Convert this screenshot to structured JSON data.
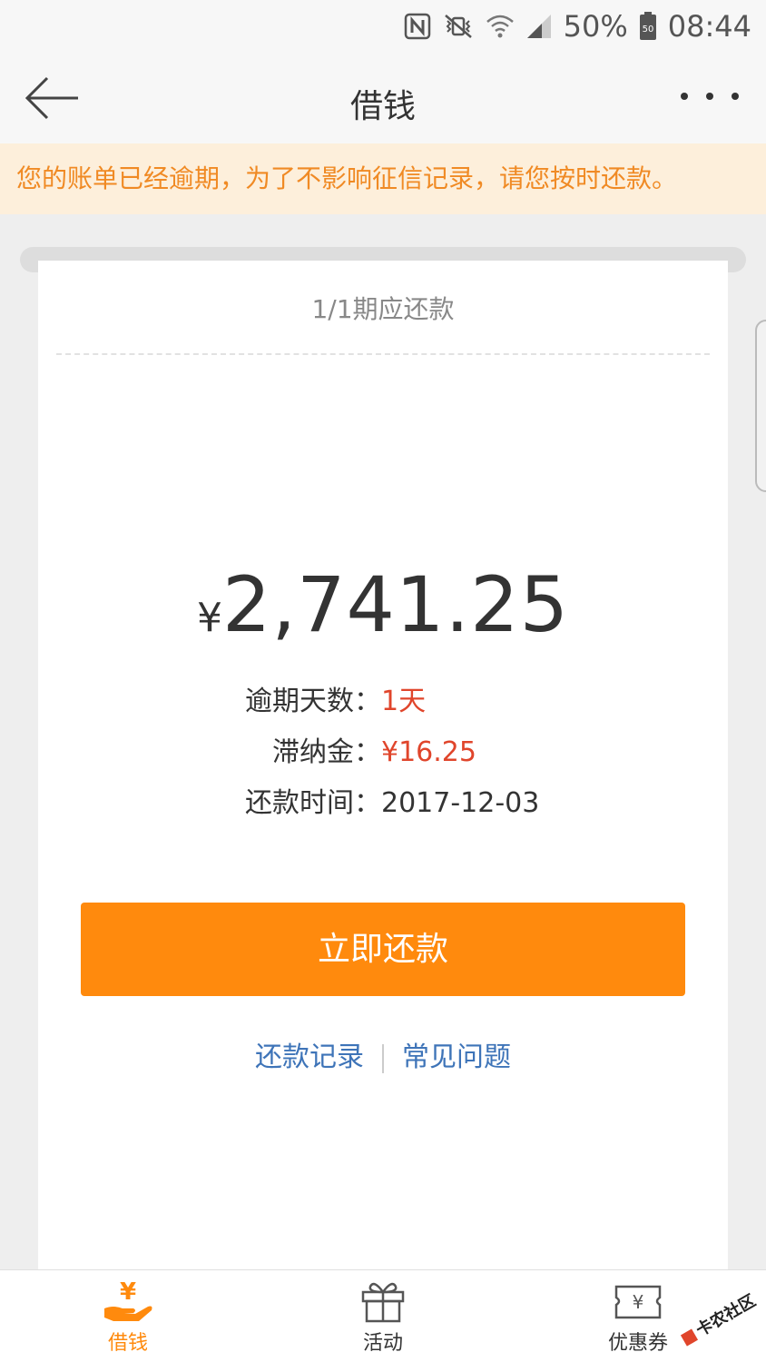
{
  "status_bar": {
    "battery_percent": "50%",
    "battery_badge": "50",
    "time": "08:44",
    "icons": [
      "nfc-icon",
      "vibrate-mute-icon",
      "wifi-icon",
      "signal-icon",
      "battery-icon"
    ]
  },
  "header": {
    "title": "借钱",
    "back_icon": "arrow-left-icon",
    "more_icon": "more-dots-icon"
  },
  "notice": {
    "text": "您的账单已经逾期，为了不影响征信记录，请您按时还款。"
  },
  "colors": {
    "accent_orange": "#ff8a0d",
    "notice_text": "#f08a24",
    "notice_bg": "#fdefdb",
    "alert_red": "#e0452b",
    "link_blue": "#3e74b8"
  },
  "bill": {
    "period_label": "1/1期应还款",
    "currency_symbol": "¥",
    "amount": "2,741.25",
    "overdue_days_label": "逾期天数：",
    "overdue_days_value": "1天",
    "late_fee_label": "滞纳金：",
    "late_fee_value": "¥16.25",
    "due_date_label": "还款时间：",
    "due_date_value": "2017-12-03"
  },
  "actions": {
    "pay_now_label": "立即还款",
    "repay_record_label": "还款记录",
    "faq_label": "常见问题"
  },
  "bottom_nav": {
    "items": [
      {
        "label": "借钱",
        "icon": "yen-hand-icon",
        "active": true
      },
      {
        "label": "活动",
        "icon": "gift-icon",
        "active": false
      },
      {
        "label": "优惠券",
        "icon": "coupon-icon",
        "active": false
      }
    ]
  },
  "watermark": {
    "text": "卡农社区"
  }
}
